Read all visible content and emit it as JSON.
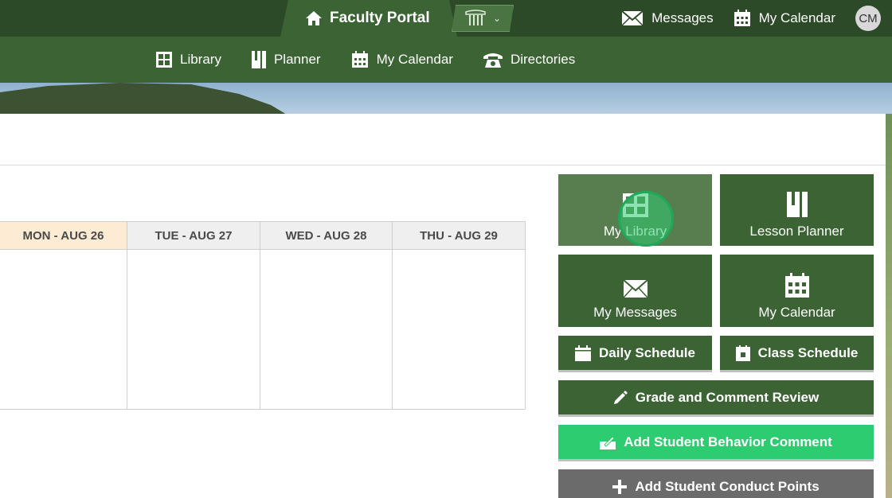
{
  "topbar": {
    "portal_label": "Faculty Portal",
    "links": [
      {
        "label": "Messages",
        "icon": "envelope-icon"
      },
      {
        "label": "My Calendar",
        "icon": "calendar-icon"
      }
    ],
    "avatar_initials": "CM"
  },
  "nav": {
    "items": [
      {
        "label": "Library",
        "icon": "grid-icon"
      },
      {
        "label": "Planner",
        "icon": "book-icon"
      },
      {
        "label": "My Calendar",
        "icon": "calendar-icon"
      },
      {
        "label": "Directories",
        "icon": "phone-icon"
      }
    ]
  },
  "calendar": {
    "days": [
      "MON - AUG 26",
      "TUE - AUG 27",
      "WED - AUG 28",
      "THU - AUG 29"
    ],
    "today_index": 0
  },
  "tiles": [
    {
      "label": "My Library",
      "icon": "grid-icon"
    },
    {
      "label": "Lesson Planner",
      "icon": "book-icon"
    },
    {
      "label": "My Messages",
      "icon": "envelope-icon"
    },
    {
      "label": "My Calendar",
      "icon": "calendar-icon"
    }
  ],
  "buttons": {
    "daily_schedule": "Daily Schedule",
    "class_schedule": "Class Schedule",
    "grade_review": "Grade and Comment Review",
    "behavior_comment": "Add Student Behavior Comment",
    "conduct_points": "Add Student Conduct Points"
  },
  "colors": {
    "topbar": "#2c4a27",
    "nav": "#3b6333",
    "tile": "#3b6333",
    "tile_hover": "#587d4e",
    "behavior_button": "#2ecc71",
    "conduct_button": "#6b6b6b",
    "today_header": "#fdebd3"
  }
}
